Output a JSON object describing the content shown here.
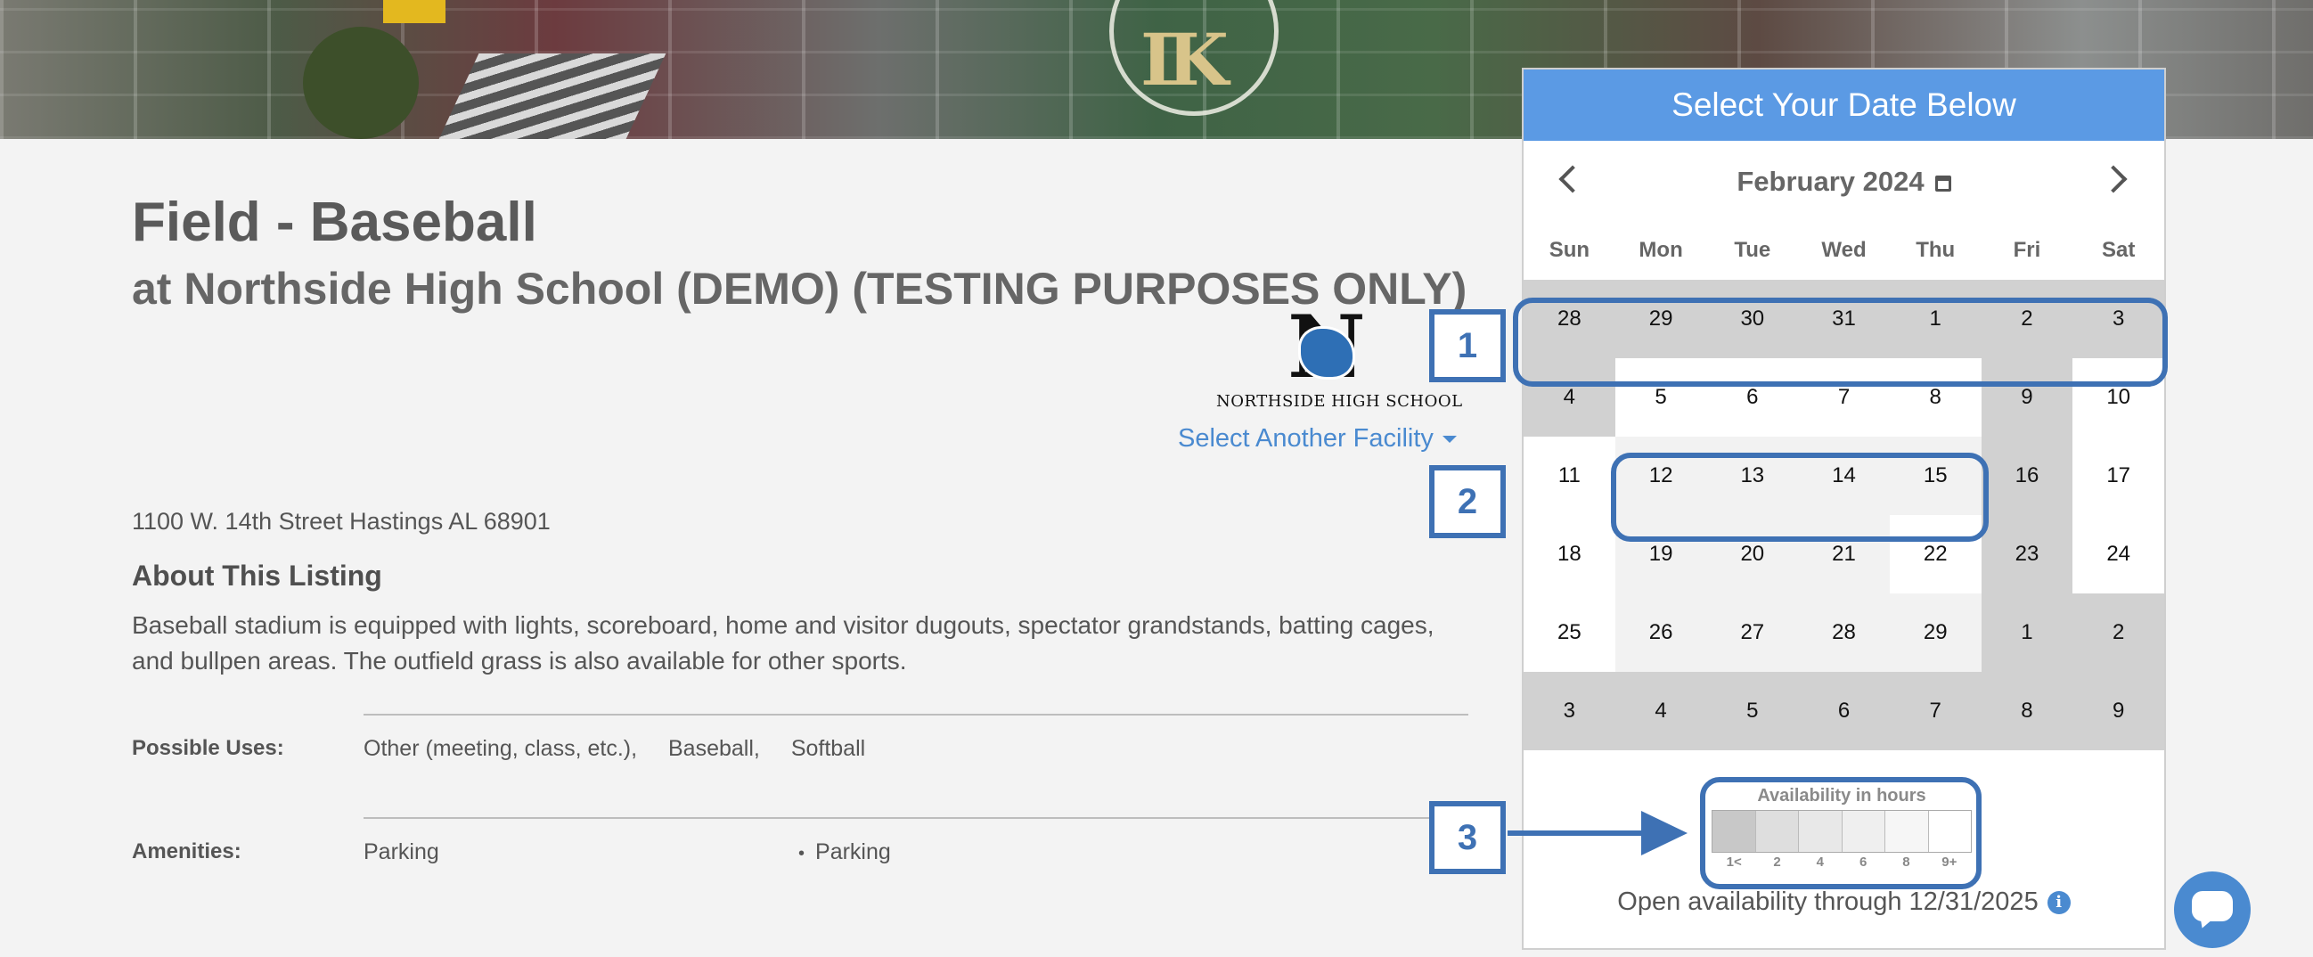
{
  "listing": {
    "title": "Field - Baseball",
    "subtitle": "at Northside High School (DEMO) (TESTING PURPOSES ONLY)",
    "school_logo_text": "NORTHSIDE HIGH SCHOOL",
    "select_facility_label": "Select Another Facility",
    "address": "1100 W. 14th Street Hastings AL 68901",
    "about_heading": "About This Listing",
    "about_text": "Baseball stadium is equipped with lights, scoreboard, home and visitor dugouts, spectator grandstands, batting cages, and bullpen areas. The outfield grass is also available for other sports.",
    "possible_uses_label": "Possible Uses:",
    "possible_uses": [
      "Other (meeting, class, etc.),",
      "Baseball,",
      "Softball"
    ],
    "amenities_label": "Amenities:",
    "amenities": [
      "Parking"
    ],
    "amenities_bullets": [
      "Parking"
    ]
  },
  "calendar": {
    "header": "Select Your Date Below",
    "month_label": "February 2024",
    "prev_icon": "chevron-left-icon",
    "next_icon": "chevron-right-icon",
    "weekdays": [
      "Sun",
      "Mon",
      "Tue",
      "Wed",
      "Thu",
      "Fri",
      "Sat"
    ],
    "weeks": [
      [
        {
          "d": "28",
          "a": 2
        },
        {
          "d": "29",
          "a": 2
        },
        {
          "d": "30",
          "a": 2
        },
        {
          "d": "31",
          "a": 2
        },
        {
          "d": "1",
          "a": 2
        },
        {
          "d": "2",
          "a": 2
        },
        {
          "d": "3",
          "a": 2
        }
      ],
      [
        {
          "d": "4",
          "a": 2
        },
        {
          "d": "5",
          "a": 0
        },
        {
          "d": "6",
          "a": 0
        },
        {
          "d": "7",
          "a": 0
        },
        {
          "d": "8",
          "a": 0
        },
        {
          "d": "9",
          "a": 2
        },
        {
          "d": "10",
          "a": 0
        }
      ],
      [
        {
          "d": "11",
          "a": 0
        },
        {
          "d": "12",
          "a": 1
        },
        {
          "d": "13",
          "a": 1
        },
        {
          "d": "14",
          "a": 1
        },
        {
          "d": "15",
          "a": 1
        },
        {
          "d": "16",
          "a": 2
        },
        {
          "d": "17",
          "a": 0
        }
      ],
      [
        {
          "d": "18",
          "a": 0
        },
        {
          "d": "19",
          "a": 1
        },
        {
          "d": "20",
          "a": 1
        },
        {
          "d": "21",
          "a": 1
        },
        {
          "d": "22",
          "a": 0
        },
        {
          "d": "23",
          "a": 2
        },
        {
          "d": "24",
          "a": 0
        }
      ],
      [
        {
          "d": "25",
          "a": 0
        },
        {
          "d": "26",
          "a": 1
        },
        {
          "d": "27",
          "a": 1
        },
        {
          "d": "28",
          "a": 1
        },
        {
          "d": "29",
          "a": 1
        },
        {
          "d": "1",
          "a": 2
        },
        {
          "d": "2",
          "a": 2
        }
      ],
      [
        {
          "d": "3",
          "a": 2
        },
        {
          "d": "4",
          "a": 2
        },
        {
          "d": "5",
          "a": 2
        },
        {
          "d": "6",
          "a": 2
        },
        {
          "d": "7",
          "a": 2
        },
        {
          "d": "8",
          "a": 2
        },
        {
          "d": "9",
          "a": 2
        }
      ]
    ],
    "legend_title": "Availability in hours",
    "legend_ticks": [
      "1<",
      "2",
      "4",
      "6",
      "8",
      "9+"
    ],
    "legend_colors": [
      "#c8c8c8",
      "#dedede",
      "#e8e8e8",
      "#efefef",
      "#f6f6f6",
      "#ffffff"
    ],
    "open_availability": "Open availability through 12/31/2025",
    "info_icon": "i"
  },
  "annotations": {
    "labels": [
      "1",
      "2",
      "3"
    ],
    "color": "#3e71b4"
  },
  "colors": {
    "header_blue": "#5b9ae4",
    "link_blue": "#4a8ad0",
    "unavailable_gray": "#d1d1d1",
    "partial_gray": "#f2f2f2"
  }
}
